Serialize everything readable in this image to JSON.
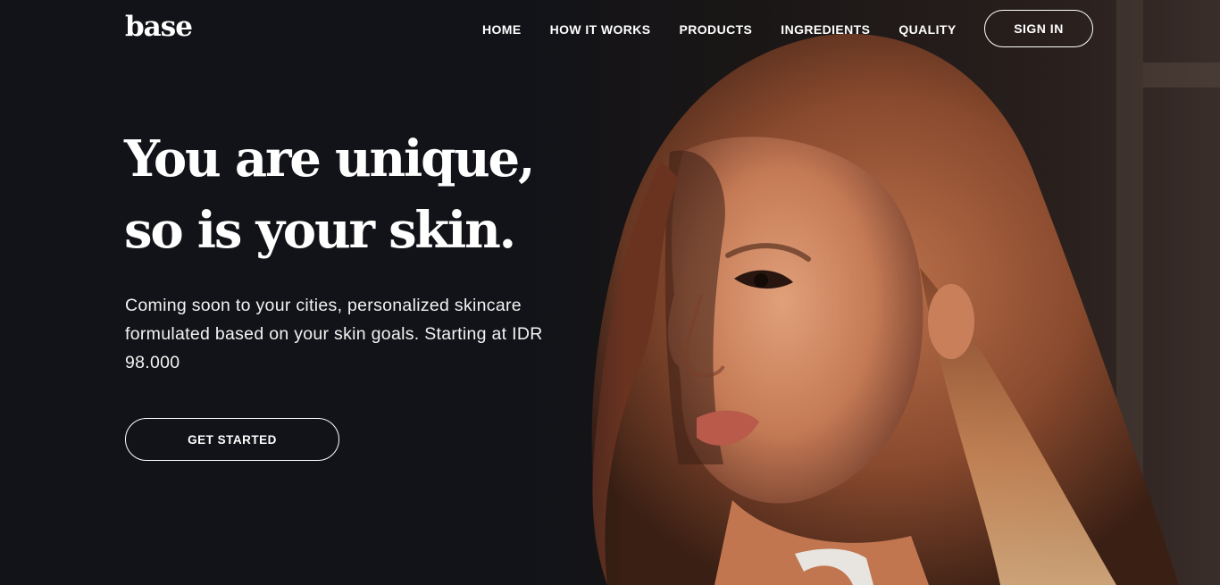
{
  "brand": {
    "logo_text": "base"
  },
  "nav": {
    "links": [
      {
        "label": "HOME"
      },
      {
        "label": "HOW IT WORKS"
      },
      {
        "label": "PRODUCTS"
      },
      {
        "label": "INGREDIENTS"
      },
      {
        "label": "QUALITY"
      }
    ],
    "signin_label": "SIGN IN"
  },
  "hero": {
    "headline_line1": "You are unique,",
    "headline_line2": "so is your skin.",
    "subtext": "Coming soon to your cities, personalized skincare formulated based on your skin goals. Starting at IDR 98.000",
    "cta_label": "GET STARTED"
  },
  "colors": {
    "background": "#121318",
    "text": "#ffffff",
    "accent_border": "#ffffff"
  }
}
